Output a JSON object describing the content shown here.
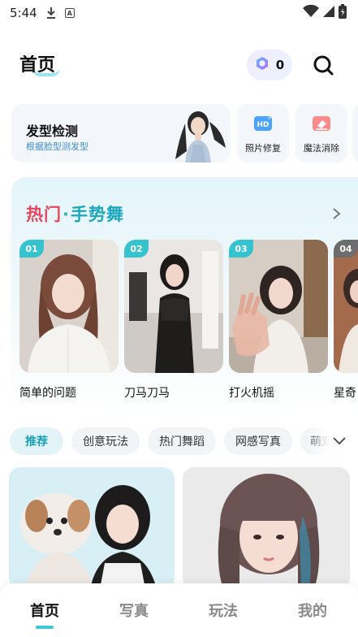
{
  "status_bar": {
    "time": "5:44"
  },
  "header": {
    "title": "首页",
    "coin_count": "0"
  },
  "features": {
    "hair": {
      "title": "发型检测",
      "subtitle": "根据脸型测发型"
    },
    "items": [
      {
        "label": "照片修复",
        "icon": "hd-icon"
      },
      {
        "label": "魔法消除",
        "icon": "eraser-icon"
      }
    ]
  },
  "hot": {
    "title_part1": "热门",
    "title_dot": "·",
    "title_part2": "手势舞",
    "videos": [
      {
        "rank": "01",
        "name": "简单的问题"
      },
      {
        "rank": "02",
        "name": "刀马刀马"
      },
      {
        "rank": "03",
        "name": "打火机摇"
      },
      {
        "rank": "04",
        "name": "星奇"
      }
    ]
  },
  "categories": [
    {
      "label": "推荐",
      "active": true
    },
    {
      "label": "创意玩法"
    },
    {
      "label": "热门舞蹈"
    },
    {
      "label": "网感写真"
    },
    {
      "label": "萌宠"
    }
  ],
  "bottom_nav": [
    {
      "label": "首页",
      "active": true
    },
    {
      "label": "写真"
    },
    {
      "label": "玩法"
    },
    {
      "label": "我的"
    }
  ],
  "colors": {
    "accent": "#34c3cf",
    "hot_red": "#e8455f",
    "hot_teal": "#1aa7bd"
  }
}
